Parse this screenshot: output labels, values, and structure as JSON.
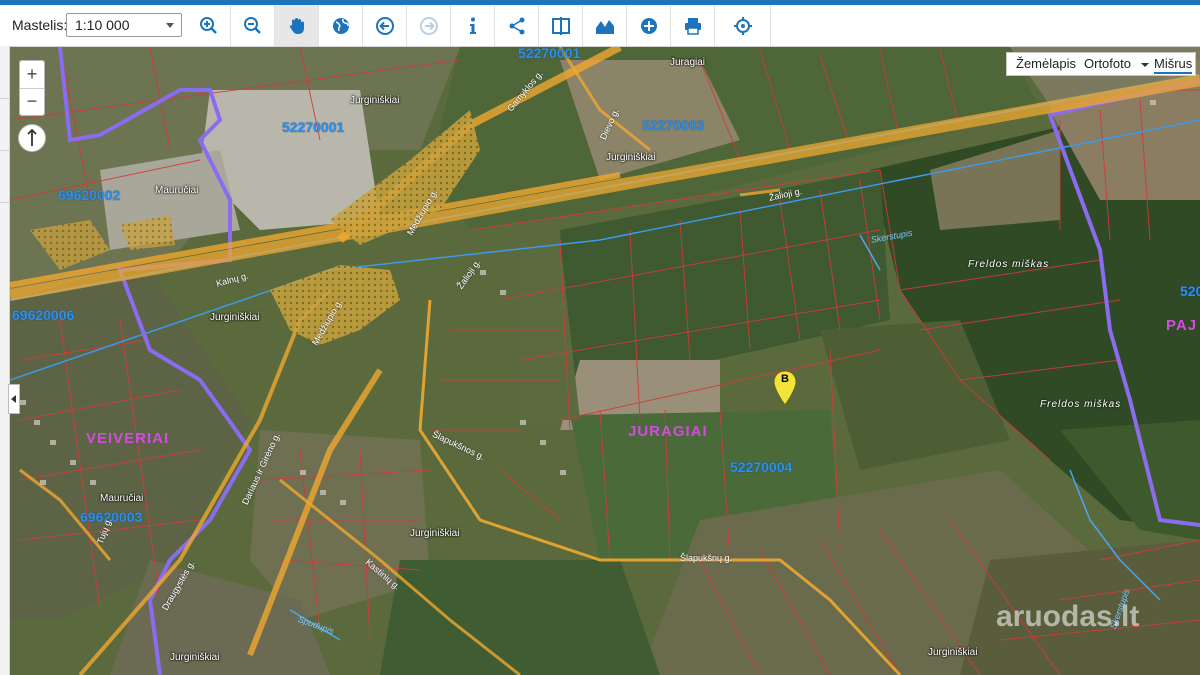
{
  "toolbar": {
    "scale_label": "Mastelis:",
    "scale_value": "1:10 000"
  },
  "icons": [
    "zoom-in-icon",
    "zoom-out-icon",
    "hand-icon",
    "globe-icon",
    "back-icon",
    "forward-icon",
    "info-icon",
    "share-icon",
    "compare-icon",
    "profile-icon",
    "add-icon",
    "print-icon",
    "locate-icon"
  ],
  "zoom": {
    "plus": "+",
    "minus": "−"
  },
  "basemap": {
    "zemelapis": "Žemėlapis",
    "ortofoto": "Ortofoto",
    "misrus": "Mišrus"
  },
  "map": {
    "parcels": [
      "52270001",
      "52270003",
      "69620002",
      "69620006",
      "69620003",
      "52270004",
      "52270005",
      "520"
    ],
    "places": [
      "Jurginiškiai",
      "Jurginiškiai",
      "Jurginiškiai",
      "Jurginiškiai",
      "Jurginiškiai",
      "Juragiai",
      "Mauručiai",
      "Mauručiai"
    ],
    "streets": [
      "Žalioji g.",
      "Dievo g.",
      "Gamyklos g.",
      "Medžiupio g.",
      "Medžiupio g.",
      "Kalėjo g.",
      "Šlapukšnų g.",
      "Šlapukšnos g.",
      "Draugystės g.",
      "Dariaus ir Girėno g.",
      "Kastinių g.",
      "Žalioji g.",
      "Tujų g.",
      "Kalnų g."
    ],
    "districts": [
      "VEIVERIAI",
      "JURAGIAI",
      "PAJ"
    ],
    "forests": [
      "Freldos miškas",
      "Freldos miškas"
    ],
    "rivers": [
      "Skerstupis",
      "Skerstupis",
      "Spudupis"
    ],
    "marker": "B",
    "watermark": "aruodas.lt"
  },
  "colors": {
    "accent": "#1c74bd",
    "parcel_line": "#c43a3a",
    "boundary": "#8b6cf0",
    "road": "#f0a830"
  }
}
